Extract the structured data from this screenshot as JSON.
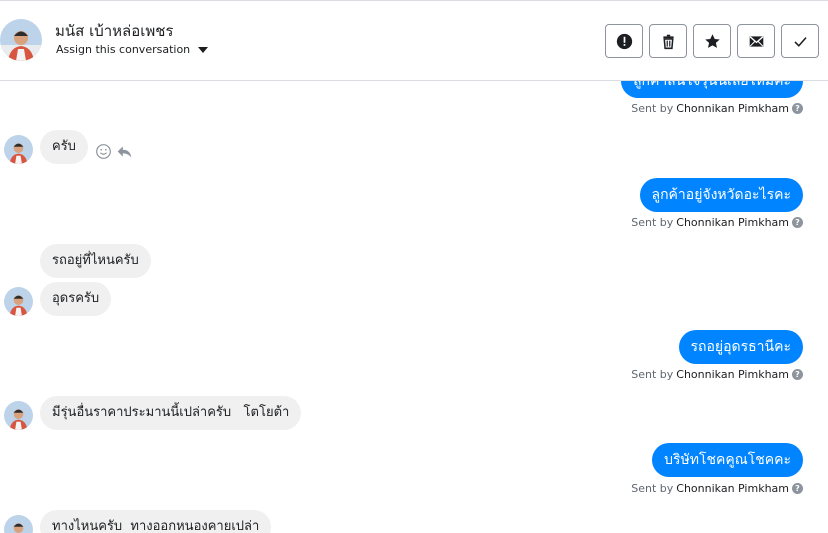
{
  "header": {
    "contact_name": "มนัส เบ้าหล่อเพชร",
    "assign_label": "Assign this conversation"
  },
  "toolbar": {
    "icons": [
      "alert-icon",
      "trash-icon",
      "star-icon",
      "mail-icon",
      "check-icon"
    ]
  },
  "thread": {
    "sent_by_prefix": "Sent by",
    "agent_name": "Chonnikan Pimkham",
    "messages": [
      {
        "dir": "out",
        "text": "ลูกค้าสนใจรุ่นนี้เลยไหมคะ"
      },
      {
        "dir": "in",
        "text": "ครับ"
      },
      {
        "dir": "out",
        "text": "ลูกค้าอยู่จังหวัดอะไรคะ"
      },
      {
        "dir": "in",
        "text": "รถอยู่ที่ไหนครับ"
      },
      {
        "dir": "in",
        "text": "อุดรครับ"
      },
      {
        "dir": "out",
        "text": "รถอยู่อุดรธานีคะ"
      },
      {
        "dir": "in",
        "text": "มีรุ่นอื่นราคาประมานนี้เปล่าครับ   โตโยต้า"
      },
      {
        "dir": "out",
        "text": "บริษัทโชคคูณโชคคะ"
      },
      {
        "dir": "in",
        "text": "ทางไหนครับ  ทางออกหนองคายเปล่า"
      }
    ]
  },
  "colors": {
    "outgoing_bubble": "#0084ff",
    "incoming_bubble": "#f0f0f0",
    "border": "#dadde1"
  }
}
